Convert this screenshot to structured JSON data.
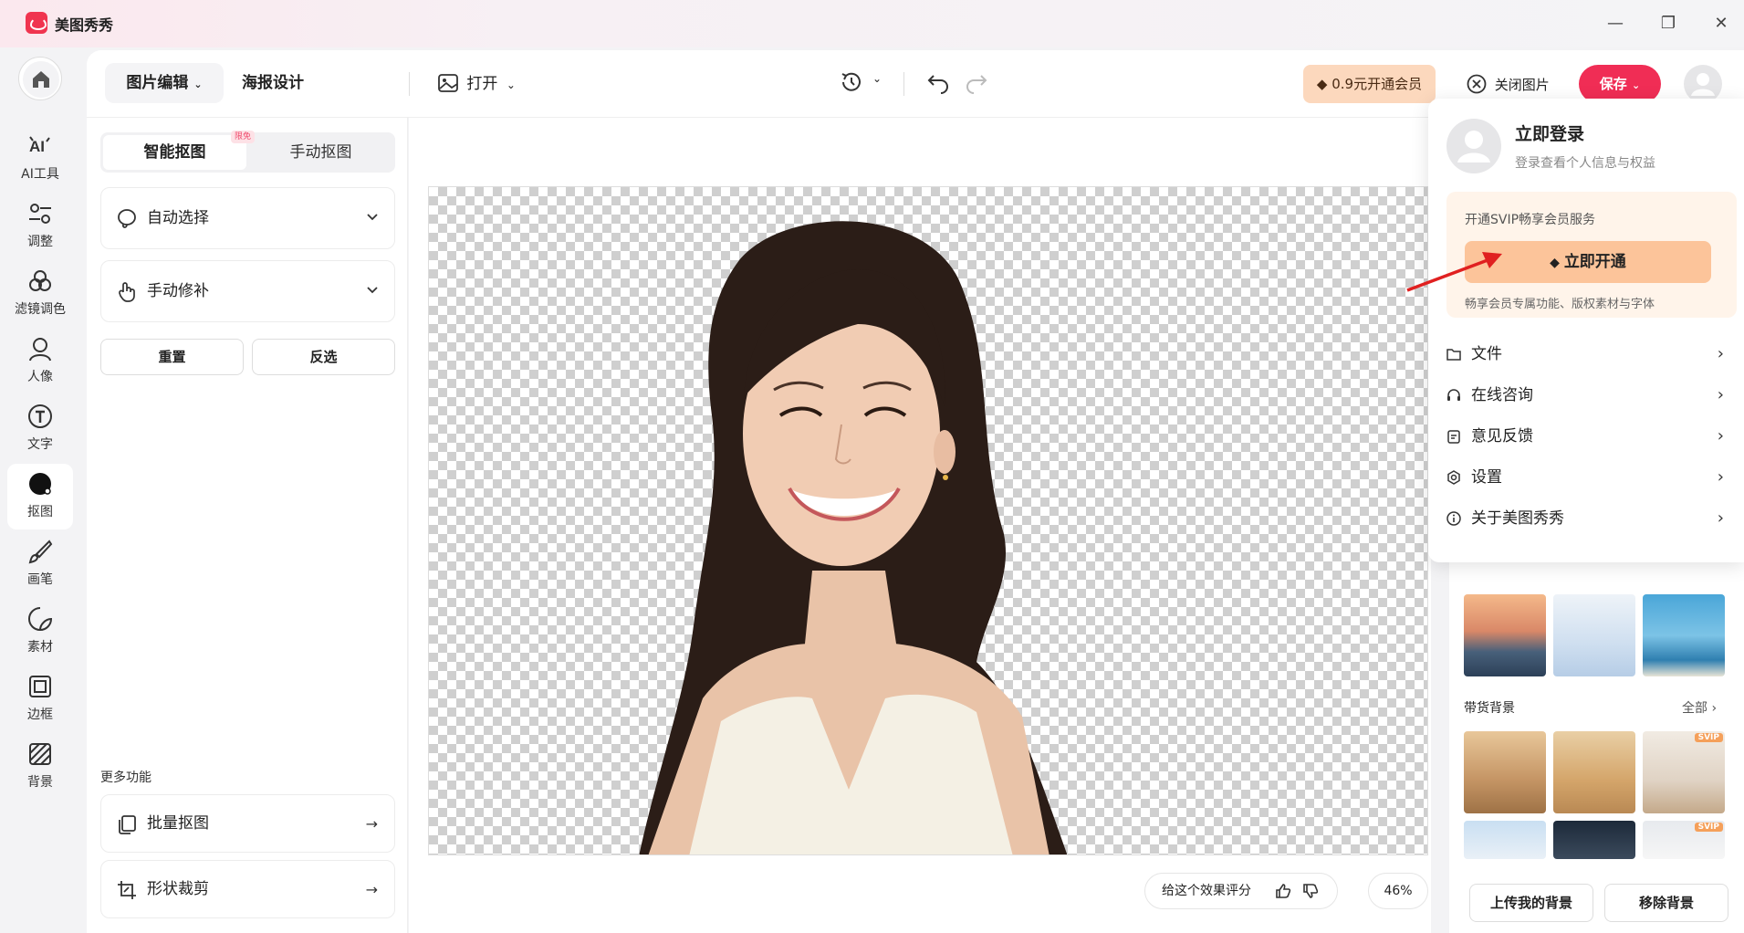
{
  "app": {
    "title": "美图秀秀"
  },
  "window": {
    "minimize": "—",
    "restore": "❐",
    "close": "✕"
  },
  "nav": {
    "items": [
      {
        "label": "AI工具",
        "icon": "ai-icon"
      },
      {
        "label": "调整",
        "icon": "adjust-icon"
      },
      {
        "label": "滤镜调色",
        "icon": "filter-icon"
      },
      {
        "label": "人像",
        "icon": "portrait-icon"
      },
      {
        "label": "文字",
        "icon": "text-icon"
      },
      {
        "label": "抠图",
        "icon": "cutout-icon",
        "active": true
      },
      {
        "label": "画笔",
        "icon": "brush-icon"
      },
      {
        "label": "素材",
        "icon": "sticker-icon"
      },
      {
        "label": "边框",
        "icon": "frame-icon"
      },
      {
        "label": "背景",
        "icon": "background-icon"
      }
    ]
  },
  "toolbar": {
    "tab_edit": "图片编辑",
    "tab_poster": "海报设计",
    "open": "打开",
    "vip": "0.9元开通会员",
    "close_image": "关闭图片",
    "save": "保存"
  },
  "left": {
    "seg_smart": "智能抠图",
    "seg_manual": "手动抠图",
    "limit_badge": "限免",
    "auto_select": "自动选择",
    "manual_fix": "手动修补",
    "reset": "重置",
    "invert": "反选",
    "more_title": "更多功能",
    "batch": "批量抠图",
    "shape_crop": "形状裁剪"
  },
  "canvas": {
    "rate": "给这个效果评分",
    "zoom": "46%"
  },
  "right": {
    "section_title": "带货背景",
    "all": "全部",
    "svip": "SVIP",
    "upload_bg": "上传我的背景",
    "remove_bg": "移除背景"
  },
  "popup": {
    "login": "立即登录",
    "login_sub": "登录查看个人信息与权益",
    "vip_title": "开通SVIP畅享会员服务",
    "vip_btn": "立即开通",
    "vip_desc": "畅享会员专属功能、版权素材与字体",
    "items": [
      {
        "label": "文件",
        "icon": "folder-icon"
      },
      {
        "label": "在线咨询",
        "icon": "headset-icon"
      },
      {
        "label": "意见反馈",
        "icon": "feedback-icon"
      },
      {
        "label": "设置",
        "icon": "settings-icon"
      },
      {
        "label": "关于美图秀秀",
        "icon": "info-icon"
      }
    ]
  }
}
